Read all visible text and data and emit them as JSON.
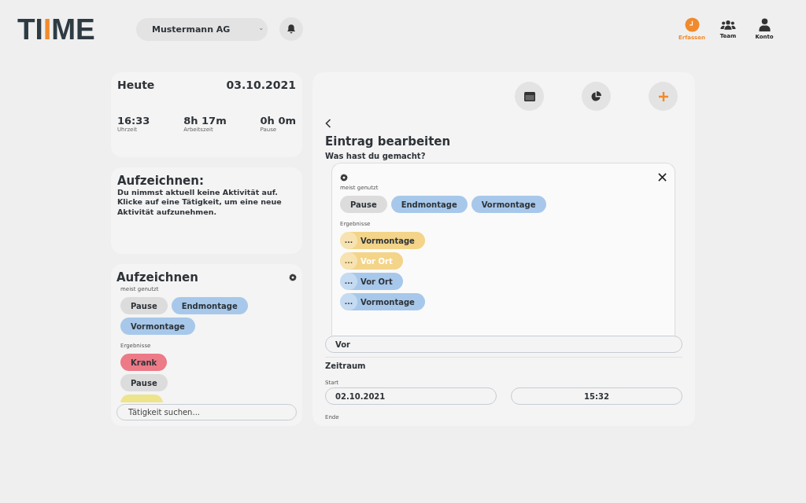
{
  "logo": {
    "parts": [
      {
        "text": "TI",
        "accent": false
      },
      {
        "text": "I",
        "accent": true
      },
      {
        "text": "ME",
        "accent": false
      }
    ]
  },
  "company_select": {
    "value": "Mustermann AG"
  },
  "nav": [
    {
      "label": "Erfassen",
      "kind": "clock",
      "selected": true
    },
    {
      "label": "Team",
      "kind": "team",
      "selected": false
    },
    {
      "label": "Konto",
      "kind": "user",
      "selected": false
    }
  ],
  "today": {
    "title": "Heute",
    "date": "03.10.2021",
    "stats": [
      {
        "value": "16:33",
        "label": "Uhrzeit"
      },
      {
        "value": "8h 17m",
        "label": "Arbeitszeit"
      },
      {
        "value": "0h 0m",
        "label": "Pause"
      }
    ]
  },
  "recording": {
    "title": "Aufzeichnen:",
    "text": "Du nimmst aktuell keine Aktivität auf. Klicke auf eine Tätigkeit, um eine neue Aktivität aufzunehmen."
  },
  "activities": {
    "title": "Aufzeichnen",
    "most_used_label": "meist genutzt",
    "most_used": [
      {
        "label": "Pause",
        "color": "#dcdcdc"
      },
      {
        "label": "Endmontage",
        "color": "#a7c8ea"
      },
      {
        "label": "Vormontage",
        "color": "#a7c8ea"
      }
    ],
    "results_label": "Ergebnisse",
    "results": [
      {
        "label": "Krank",
        "color": "#ec7a87"
      },
      {
        "label": "Pause",
        "color": "#dcdcdc"
      },
      {
        "color": "#ede48c"
      }
    ],
    "search": {
      "placeholder": "Tätigkeit suchen..."
    }
  },
  "editor": {
    "toolbar": [
      {
        "kind": "calendar"
      },
      {
        "kind": "pie"
      },
      {
        "kind": "plus"
      }
    ],
    "title": "Eintrag bearbeiten",
    "question": "Was hast du gemacht?",
    "picker": {
      "most_used_label": "meist genutzt",
      "most_used": [
        {
          "label": "Pause",
          "color": "#dcdcdc"
        },
        {
          "label": "Endmontage",
          "color": "#a7c8ea"
        },
        {
          "label": "Vormontage",
          "color": "#a7c8ea"
        }
      ],
      "results_label": "Ergebnisse",
      "results": [
        {
          "more": "...",
          "label": "Vormontage",
          "color": "#f3d488",
          "disabled": false
        },
        {
          "more": "...",
          "label": "Vor Ort",
          "color": "#f3d488",
          "disabled": true
        },
        {
          "more": "...",
          "label": "Vor Ort",
          "color": "#a7c8ea",
          "disabled": false
        },
        {
          "more": "...",
          "label": "Vormontage",
          "color": "#a7c8ea",
          "disabled": false
        }
      ]
    },
    "search_value": "Vor",
    "period_title": "Zeitraum",
    "start_label": "Start",
    "start_date": "02.10.2021",
    "start_time": "15:32",
    "end_label": "Ende"
  }
}
